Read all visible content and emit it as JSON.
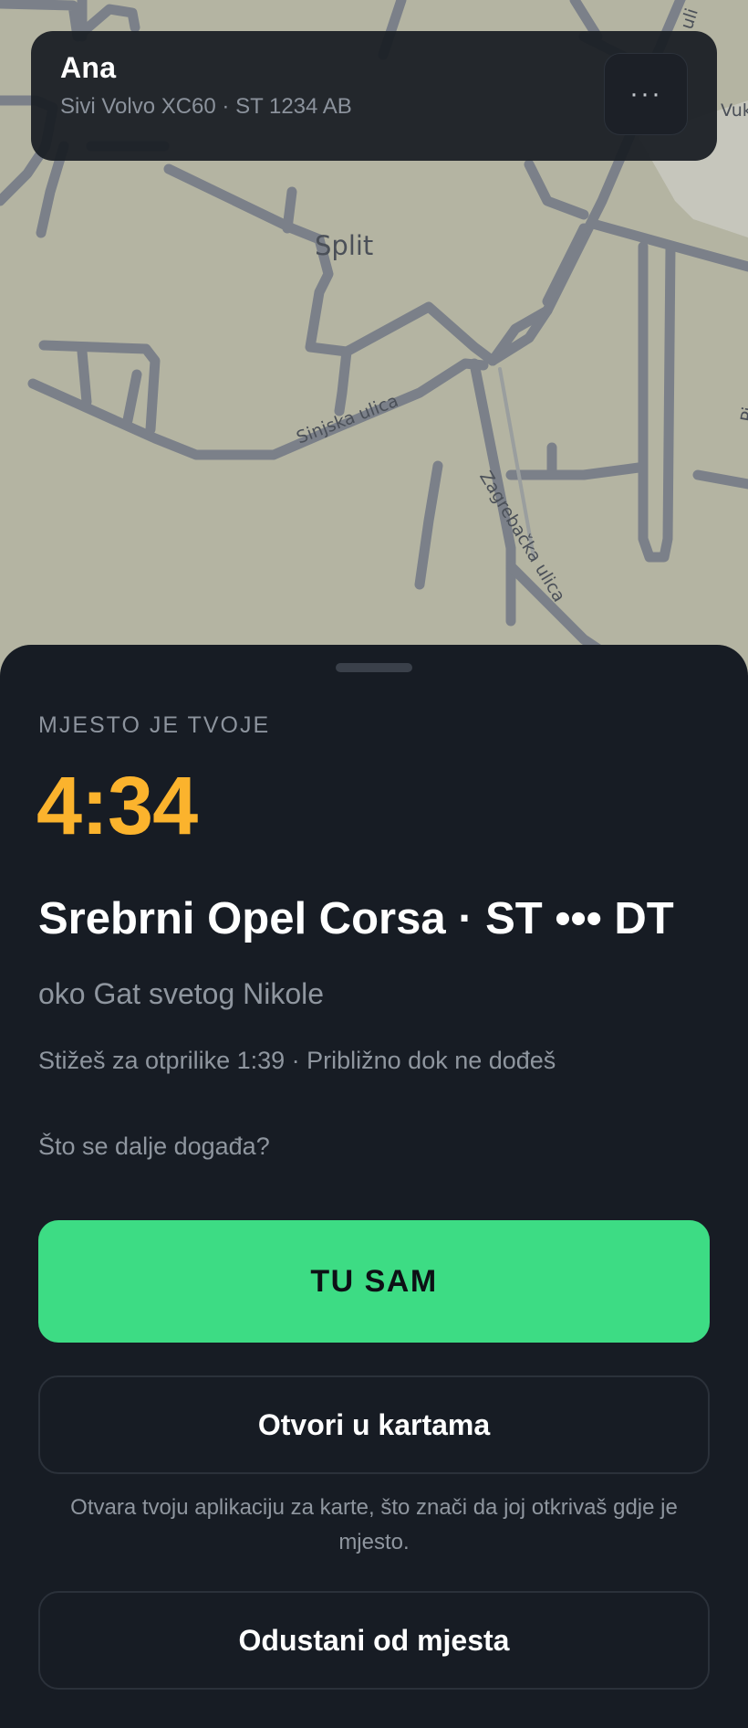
{
  "map": {
    "city": "Split",
    "streets": {
      "sinjska": "Sinjska ulica",
      "zagrebacka": "Zagrebačka ulica",
      "vuk": "Vuk",
      "top_right": "uli",
      "right": "Pi"
    }
  },
  "driver_card": {
    "name": "Ana",
    "vehicle": "Sivi Volvo XC60 · ST 1234 AB",
    "more_glyph": "···"
  },
  "sheet": {
    "eyebrow": "MJESTO JE TVOJE",
    "timer": "4:34",
    "car_title": "Srebrni Opel Corsa · ST ••• DT",
    "location": "oko Gat svetog Nikole",
    "eta": "Stižeš za otprilike 1:39 · Približno dok ne dođeš",
    "next_link": "Što se dalje događa?",
    "primary_button": "TU SAM",
    "maps_button": "Otvori u kartama",
    "maps_note": "Otvara tvoju aplikaciju za karte, što znači da joj otkrivaš gdje je mjesto.",
    "cancel_button": "Odustani od mjesta"
  },
  "colors": {
    "accent_timer": "#fbb32d",
    "primary_button": "#3ddc84",
    "sheet_bg": "#171c24",
    "map_bg": "#b4b4a2",
    "road": "#7b8089"
  }
}
